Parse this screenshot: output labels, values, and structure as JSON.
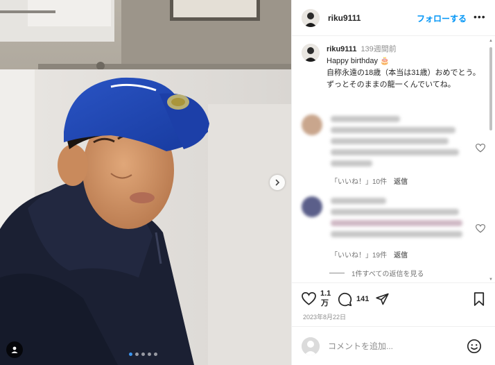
{
  "post": {
    "username": "riku9111",
    "follow_label": "フォローする",
    "more_label": "•••"
  },
  "caption": {
    "username": "riku9111",
    "time": "139週間前",
    "line1": "Happy birthday 🎂",
    "line2": "自称永遠の18歳（本当は31歳）おめでとう。",
    "line3": "ずっとそのままの龍一くんでいてね。"
  },
  "comments": [
    {
      "likes_label": "「いいね！」10件",
      "reply_label": "返信"
    },
    {
      "likes_label": "「いいね！」19件",
      "reply_label": "返信"
    }
  ],
  "view_replies": "1件すべての返信を見る",
  "actions": {
    "likes_count_line1": "1.1",
    "likes_count_line2": "万",
    "comments_count": "141",
    "date": "2023年8月22日"
  },
  "comment_box": {
    "placeholder": "コメントを追加..."
  },
  "icons": {
    "heart": "heart-icon",
    "comment": "comment-icon",
    "share": "share-icon",
    "bookmark": "bookmark-icon",
    "emoji": "emoji-icon",
    "next": "chevron-right-icon",
    "user_tag": "user-tag-icon"
  },
  "colors": {
    "accent": "#0095f6",
    "text": "#262626",
    "muted": "#8e8e8e",
    "carousel_active": "#3b95f0"
  },
  "carousel": {
    "current": 1,
    "total": 5
  }
}
